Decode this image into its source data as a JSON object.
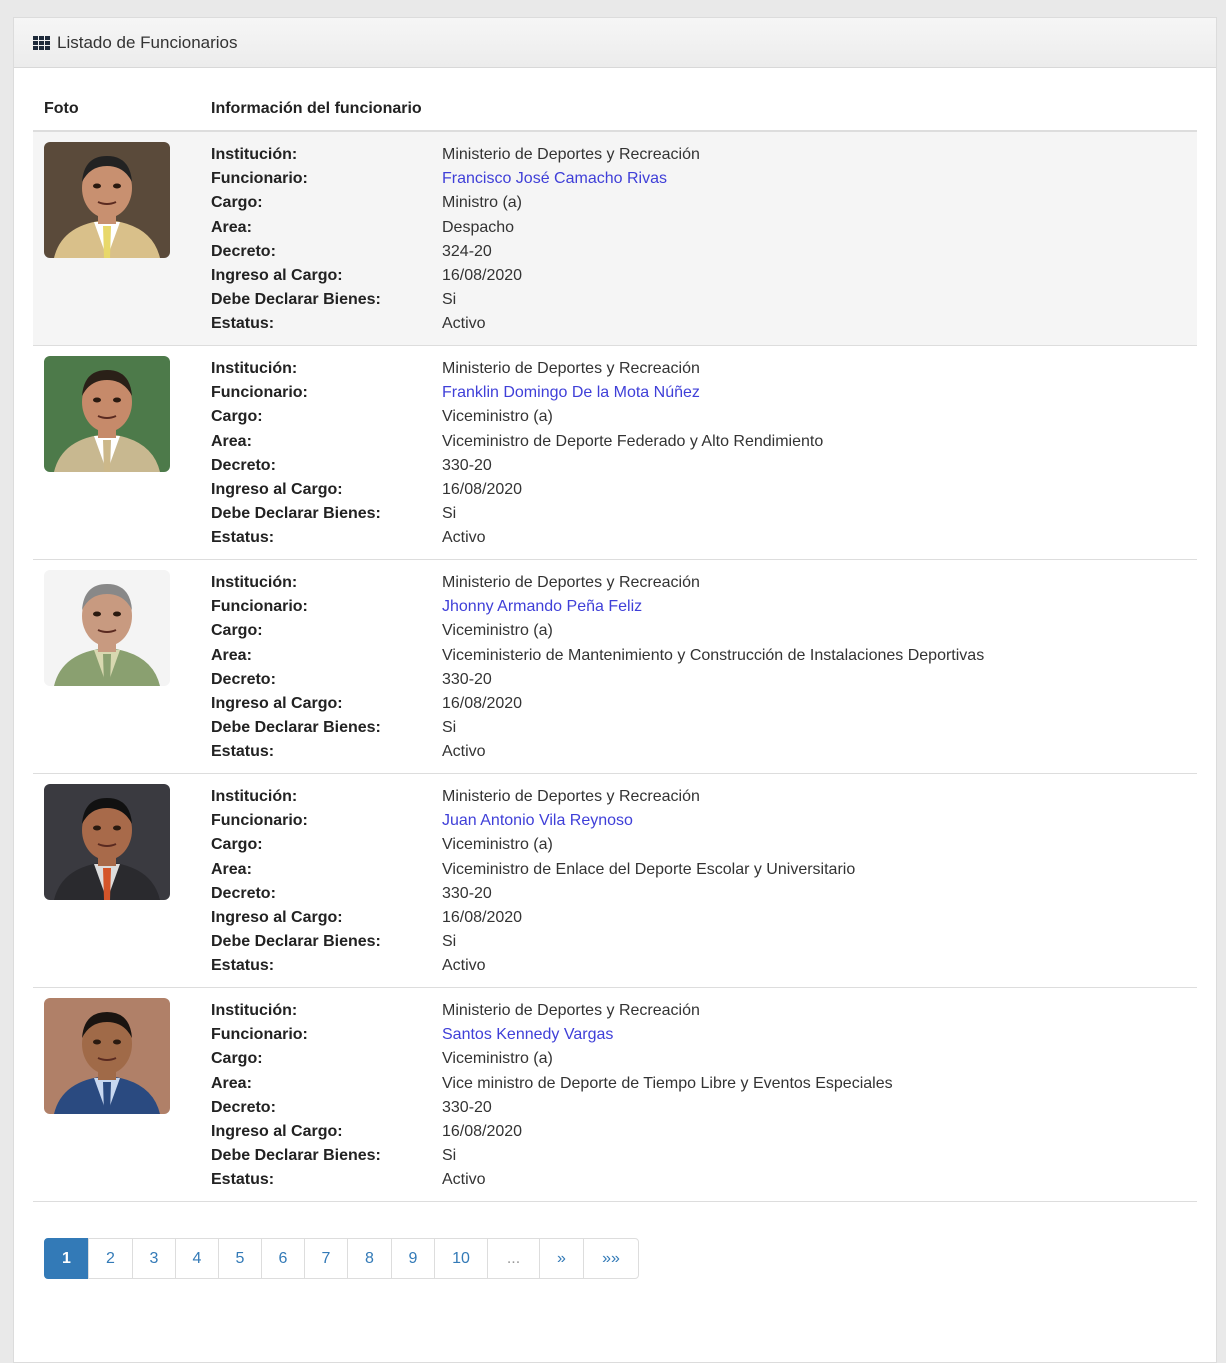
{
  "panel": {
    "title": "Listado de Funcionarios",
    "icon": "grid-icon"
  },
  "table": {
    "col_photo": "Foto",
    "col_info": "Información del funcionario"
  },
  "labels": {
    "institucion": "Institución:",
    "funcionario": "Funcionario:",
    "cargo": "Cargo:",
    "area": "Area:",
    "decreto": "Decreto:",
    "ingreso": "Ingreso al Cargo:",
    "declarar": "Debe Declarar Bienes:",
    "estatus": "Estatus:"
  },
  "officials": [
    {
      "institucion": "Ministerio de Deportes y Recreación",
      "funcionario": "Francisco José Camacho Rivas",
      "cargo": "Ministro (a)",
      "area": "Despacho",
      "decreto": "324-20",
      "ingreso": "16/08/2020",
      "declarar": "Si",
      "estatus": "Activo"
    },
    {
      "institucion": "Ministerio de Deportes y Recreación",
      "funcionario": "Franklin Domingo De la Mota Núñez",
      "cargo": "Viceministro (a)",
      "area": "Viceministro de Deporte Federado y Alto Rendimiento",
      "decreto": "330-20",
      "ingreso": "16/08/2020",
      "declarar": "Si",
      "estatus": "Activo"
    },
    {
      "institucion": "Ministerio de Deportes y Recreación",
      "funcionario": "Jhonny Armando Peña Feliz",
      "cargo": "Viceministro (a)",
      "area": "Viceministerio de Mantenimiento y Construcción de Instalaciones Deportivas",
      "decreto": "330-20",
      "ingreso": "16/08/2020",
      "declarar": "Si",
      "estatus": "Activo"
    },
    {
      "institucion": "Ministerio de Deportes y Recreación",
      "funcionario": "Juan Antonio Vila Reynoso",
      "cargo": "Viceministro (a)",
      "area": "Viceministro de Enlace del Deporte Escolar y Universitario",
      "decreto": "330-20",
      "ingreso": "16/08/2020",
      "declarar": "Si",
      "estatus": "Activo"
    },
    {
      "institucion": "Ministerio de Deportes y Recreación",
      "funcionario": "Santos Kennedy Vargas",
      "cargo": "Viceministro (a)",
      "area": "Vice ministro de Deporte de Tiempo Libre y Eventos Especiales",
      "decreto": "330-20",
      "ingreso": "16/08/2020",
      "declarar": "Si",
      "estatus": "Activo"
    }
  ],
  "pagination": {
    "pages": [
      "1",
      "2",
      "3",
      "4",
      "5",
      "6",
      "7",
      "8",
      "9",
      "10"
    ],
    "active": "1",
    "ellipsis": "...",
    "next": "»",
    "last": "»»"
  }
}
